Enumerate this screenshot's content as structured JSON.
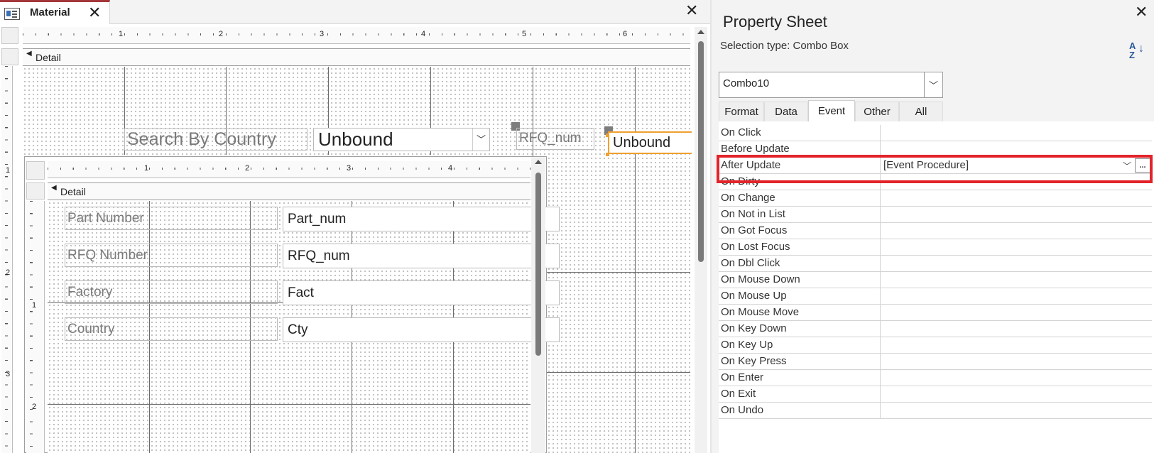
{
  "document_tab": {
    "title": "Material"
  },
  "ruler": {
    "main_numbers": [
      "1",
      "2",
      "3",
      "4",
      "5",
      "6"
    ],
    "sub_numbers": [
      "1",
      "2",
      "3",
      "4"
    ],
    "vertical_numbers": [
      "1",
      "2",
      "3"
    ],
    "sub_vertical_numbers": [
      "1",
      "2"
    ]
  },
  "main_form": {
    "section_label": "Detail",
    "search_label": "Search By Country",
    "search_combo_value": "Unbound",
    "rfq_label": "RFQ_num",
    "selected_combo_value": "Unbound"
  },
  "subform": {
    "section_label": "Detail",
    "fields": [
      {
        "label": "Part Number",
        "control": "Part_num"
      },
      {
        "label": "RFQ Number",
        "control": "RFQ_num"
      },
      {
        "label": "Factory",
        "control": "Fact"
      },
      {
        "label": "Country",
        "control": "Cty"
      }
    ]
  },
  "property_sheet": {
    "title": "Property Sheet",
    "selection_type": "Selection type:  Combo Box",
    "sort_icon": "A↓Z sort icon",
    "object_selector": "Combo10",
    "tabs": [
      {
        "label": "Format",
        "active": false
      },
      {
        "label": "Data",
        "active": false
      },
      {
        "label": "Event",
        "active": true
      },
      {
        "label": "Other",
        "active": false
      },
      {
        "label": "All",
        "active": false
      }
    ],
    "rows": [
      {
        "name": "On Click",
        "value": ""
      },
      {
        "name": "Before Update",
        "value": ""
      },
      {
        "name": "After Update",
        "value": "[Event Procedure]"
      },
      {
        "name": "On Dirty",
        "value": ""
      },
      {
        "name": "On Change",
        "value": ""
      },
      {
        "name": "On Not in List",
        "value": ""
      },
      {
        "name": "On Got Focus",
        "value": ""
      },
      {
        "name": "On Lost Focus",
        "value": ""
      },
      {
        "name": "On Dbl Click",
        "value": ""
      },
      {
        "name": "On Mouse Down",
        "value": ""
      },
      {
        "name": "On Mouse Up",
        "value": ""
      },
      {
        "name": "On Mouse Move",
        "value": ""
      },
      {
        "name": "On Key Down",
        "value": ""
      },
      {
        "name": "On Key Up",
        "value": ""
      },
      {
        "name": "On Key Press",
        "value": ""
      },
      {
        "name": "On Enter",
        "value": ""
      },
      {
        "name": "On Exit",
        "value": ""
      },
      {
        "name": "On Undo",
        "value": ""
      }
    ],
    "build_button": "...",
    "highlight_color": "#e3232a"
  },
  "colors": {
    "tab_accent": "#a4373a",
    "selection_handle": "#f0a030"
  }
}
